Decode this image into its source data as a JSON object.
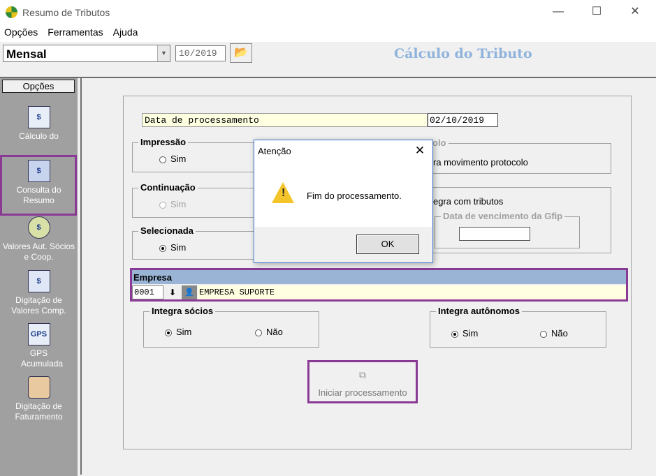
{
  "window": {
    "title": "Resumo de Tributos",
    "min": "—",
    "max": "☐",
    "close": "✕"
  },
  "menu": [
    "Opções",
    "Ferramentas",
    "Ajuda"
  ],
  "toolbar": {
    "period": "Mensal",
    "month": "10/2019",
    "heading": "Cálculo do Tributo"
  },
  "sidebar": {
    "header": "Opções",
    "items": [
      {
        "label": "Cálculo do Tributo",
        "icon": "$"
      },
      {
        "label": "Consulta do Resumo",
        "icon": "$"
      },
      {
        "label": "Valores Aut. Sócios e  Coop.",
        "icon": "$"
      },
      {
        "label": "Digitação de Valores Comp.",
        "icon": "$"
      },
      {
        "label": "GPS Acumulada",
        "icon": "GPS"
      },
      {
        "label": "Digitação de Faturamento",
        "icon": ""
      }
    ]
  },
  "form": {
    "date_label": "Data de processamento",
    "date_value": "02/10/2019",
    "impressao": {
      "title": "Impressão",
      "opt": "Sim"
    },
    "continuacao": {
      "title": "Continuação",
      "opt": "Sim"
    },
    "selecionada": {
      "title": "Selecionada",
      "opt": "Sim"
    },
    "protocolo": {
      "title_partial": "olo",
      "text": "ra movimento protocolo"
    },
    "tributos": {
      "text": "egra com tributos",
      "gfip_title": "Data de vencimento da Gfip",
      "gfip_value": ""
    },
    "empresa": {
      "title": "Empresa",
      "code": "0001",
      "name": "EMPRESA SUPORTE"
    },
    "socios": {
      "title": "Integra sócios",
      "yes": "Sim",
      "no": "Não"
    },
    "autonomos": {
      "title": "Integra autônomos",
      "yes": "Sim",
      "no": "Não"
    },
    "process_button": "Iniciar processamento"
  },
  "dialog": {
    "title": "Atenção",
    "message": "Fim do processamento.",
    "ok": "OK",
    "close": "✕"
  }
}
